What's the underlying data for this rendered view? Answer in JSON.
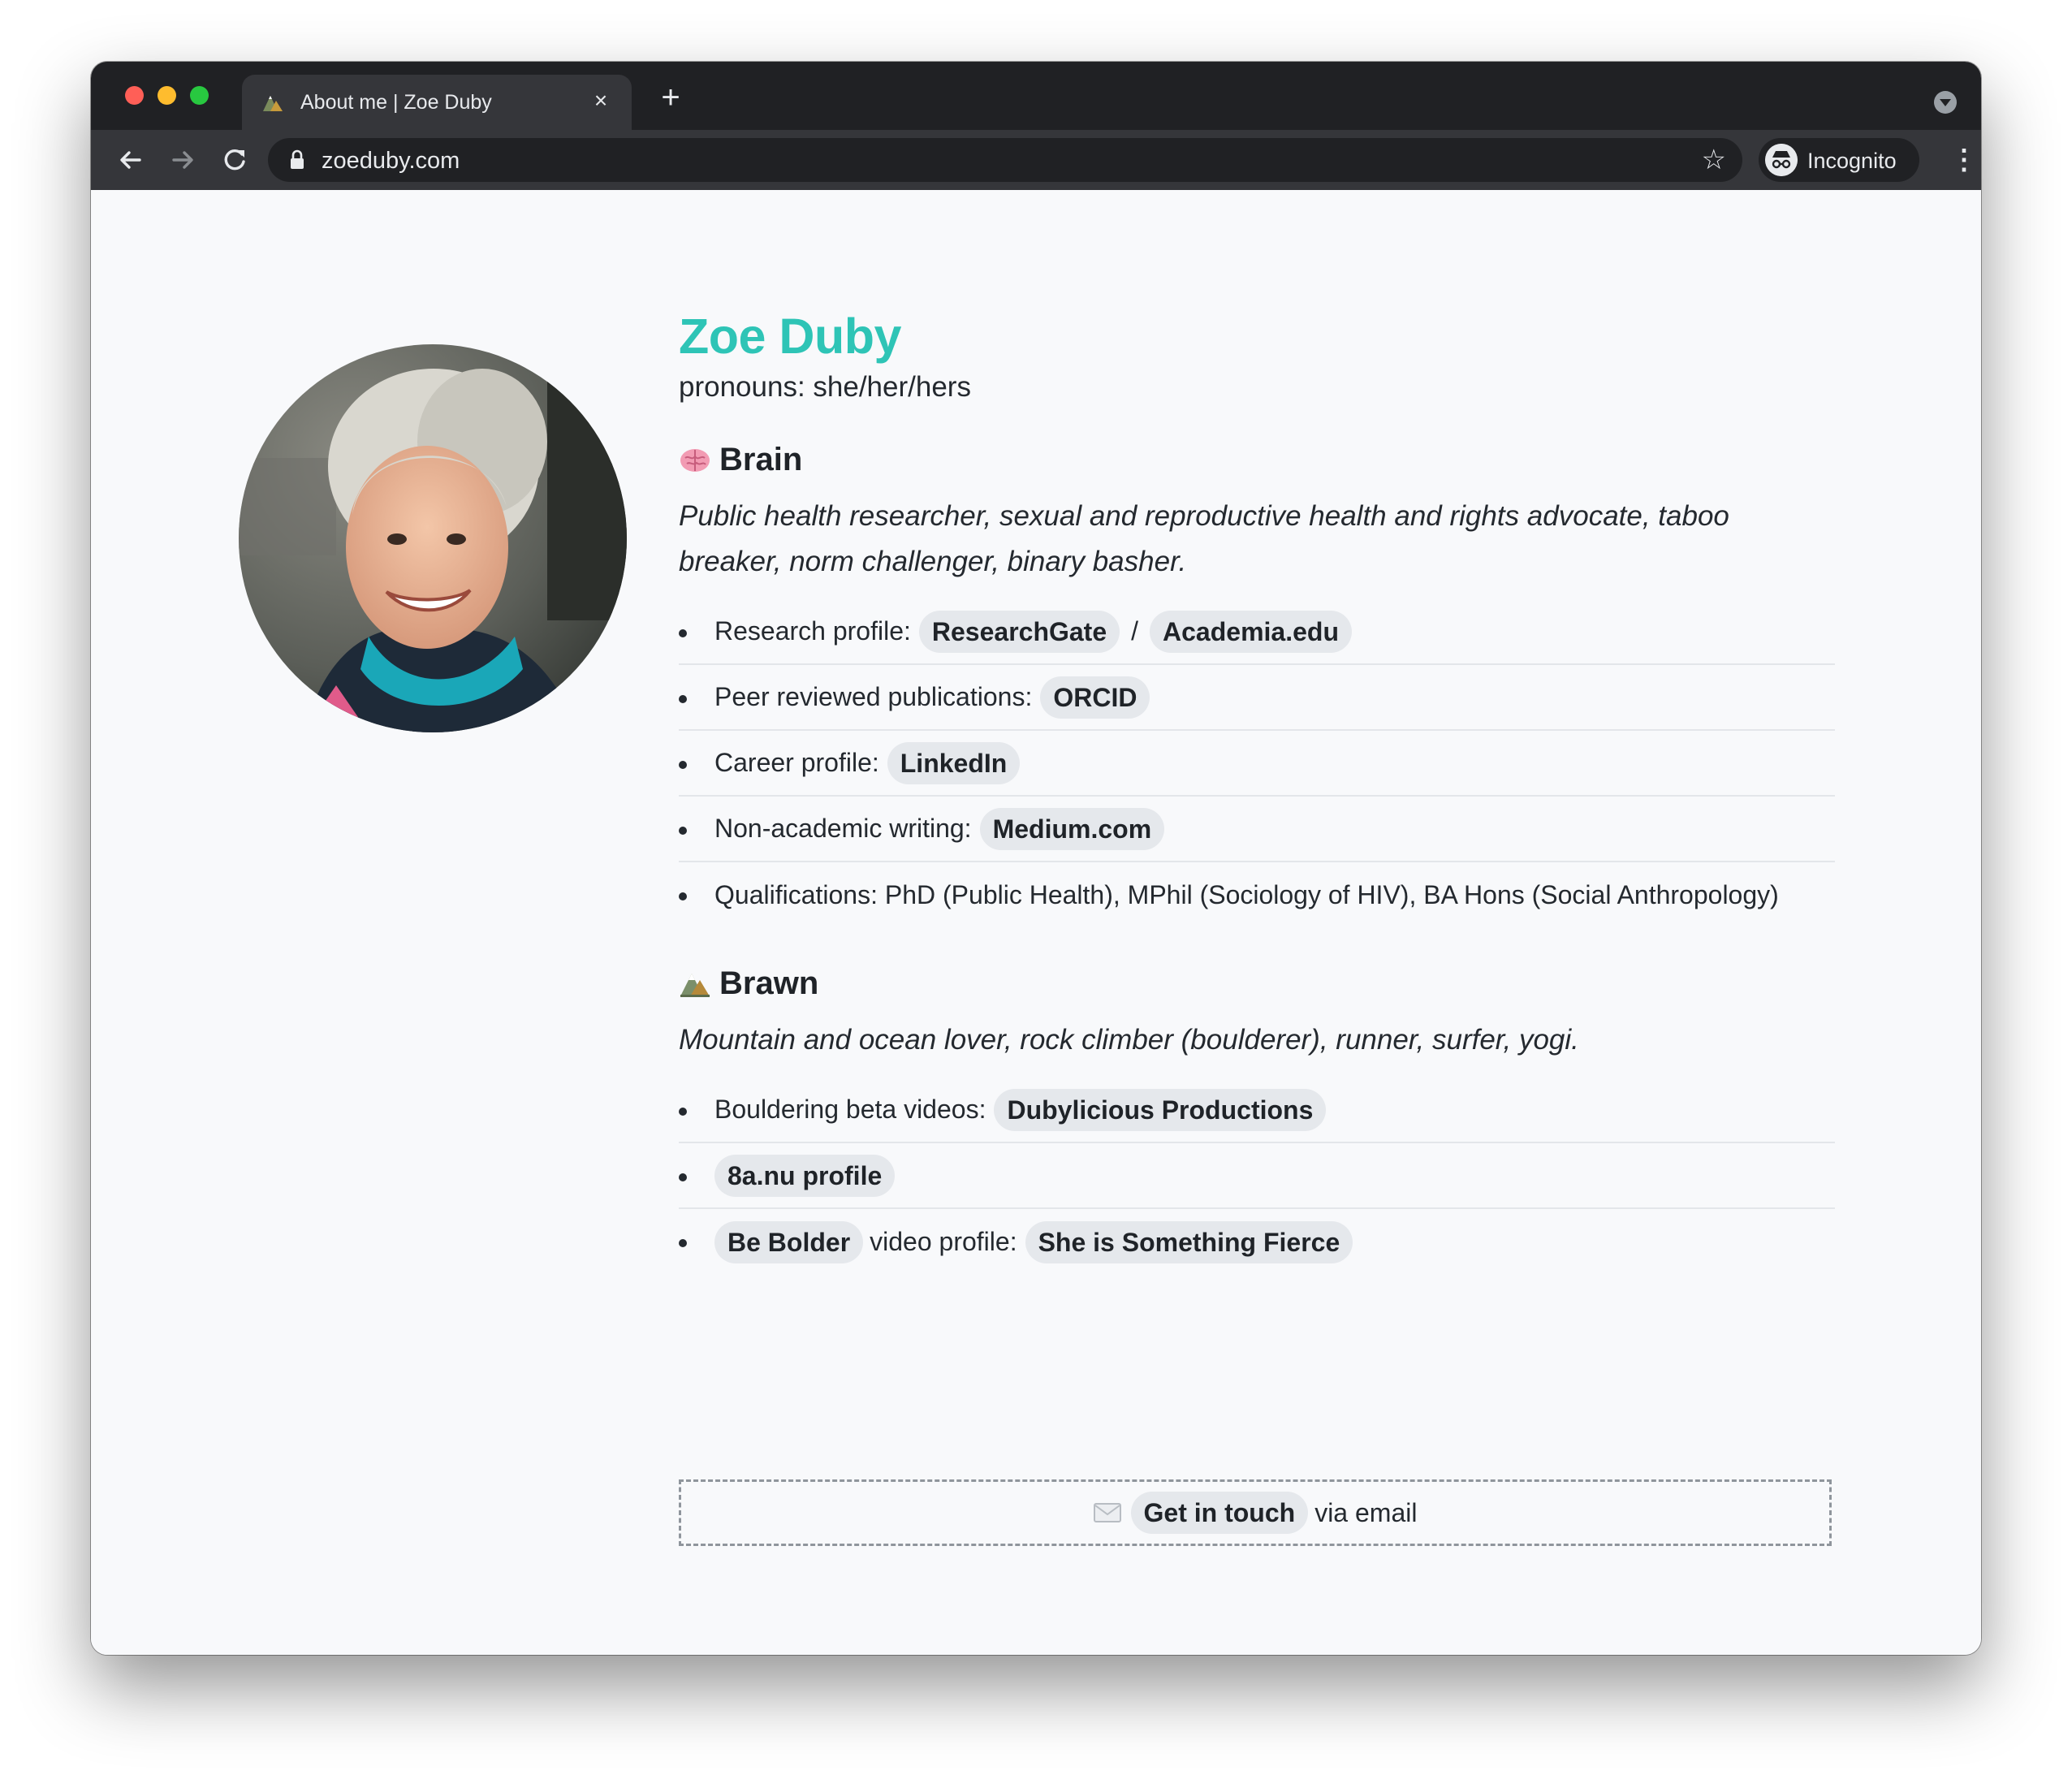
{
  "browser": {
    "tab_title": "About me | Zoe Duby",
    "tab_close": "×",
    "new_tab": "+",
    "url": "zoeduby.com",
    "profile_label": "Incognito"
  },
  "profile": {
    "name": "Zoe Duby",
    "pronouns": "pronouns: she/her/hers"
  },
  "brain": {
    "heading": "Brain",
    "description": "Public health researcher, sexual and reproductive health and rights advocate, taboo breaker, norm challenger, binary basher.",
    "items": [
      {
        "label": "Research profile:",
        "link1": "ResearchGate",
        "separator": "/",
        "link2": "Academia.edu"
      },
      {
        "label": "Peer reviewed publications:",
        "link1": "ORCID"
      },
      {
        "label": "Career profile:",
        "link1": "LinkedIn"
      },
      {
        "label": "Non-academic writing:",
        "link1": "Medium.com"
      },
      {
        "label": "Qualifications: PhD (Public Health), MPhil (Sociology of HIV), BA Hons (Social Anthropology)"
      }
    ]
  },
  "brawn": {
    "heading": "Brawn",
    "description": "Mountain and ocean lover, rock climber (boulderer), runner, surfer, yogi.",
    "items": [
      {
        "label": "Bouldering beta videos:",
        "link1": "Dubylicious Productions"
      },
      {
        "link1": "8a.nu profile"
      },
      {
        "link1": "Be Bolder",
        "middle": "video profile:",
        "link2": "She is Something Fierce"
      }
    ]
  },
  "contact": {
    "link": "Get in touch",
    "suffix": "via email"
  },
  "colors": {
    "accent": "#2ec4b6",
    "chrome_dark": "#202124",
    "chrome_toolbar": "#35363a",
    "page_bg": "#f8f9fb",
    "pill_bg": "#e5e8ec"
  },
  "icons": {
    "brain": "brain-emoji-icon",
    "brawn": "mountain-emoji-icon",
    "contact": "envelope-icon",
    "favicon": "mountain-favicon-icon"
  }
}
